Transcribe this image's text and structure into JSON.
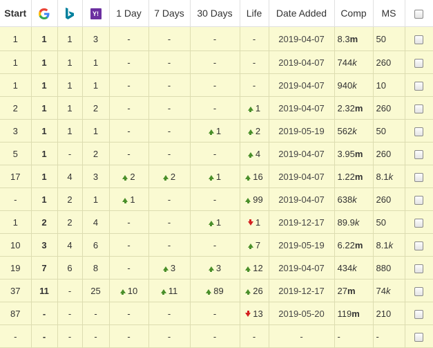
{
  "columns": {
    "start": "Start",
    "one_day": "1 Day",
    "seven_days": "7 Days",
    "thirty_days": "30 Days",
    "life": "Life",
    "date_added": "Date Added",
    "comp": "Comp",
    "ms": "MS"
  },
  "icons": {
    "google": "google-icon",
    "bing": "bing-icon",
    "yahoo": "yahoo-icon",
    "yahoo_glyph": "Y!"
  },
  "colors": {
    "row_bg": "#fafad2",
    "up": "#4a8f2a",
    "down": "#d42020"
  },
  "rows": [
    {
      "start": "1",
      "google": "1",
      "bing": "1",
      "yahoo": "3",
      "d1": {
        "t": "-",
        "dir": ""
      },
      "d7": {
        "t": "-",
        "dir": ""
      },
      "d30": {
        "t": "-",
        "dir": ""
      },
      "life": {
        "t": "-",
        "dir": ""
      },
      "date": "2019-04-07",
      "comp_num": "8.3",
      "comp_sfx": "m",
      "ms_num": "50",
      "ms_sfx": ""
    },
    {
      "start": "1",
      "google": "1",
      "bing": "1",
      "yahoo": "1",
      "d1": {
        "t": "-",
        "dir": ""
      },
      "d7": {
        "t": "-",
        "dir": ""
      },
      "d30": {
        "t": "-",
        "dir": ""
      },
      "life": {
        "t": "-",
        "dir": ""
      },
      "date": "2019-04-07",
      "comp_num": "744",
      "comp_sfx": "k",
      "ms_num": "260",
      "ms_sfx": ""
    },
    {
      "start": "1",
      "google": "1",
      "bing": "1",
      "yahoo": "1",
      "d1": {
        "t": "-",
        "dir": ""
      },
      "d7": {
        "t": "-",
        "dir": ""
      },
      "d30": {
        "t": "-",
        "dir": ""
      },
      "life": {
        "t": "-",
        "dir": ""
      },
      "date": "2019-04-07",
      "comp_num": "940",
      "comp_sfx": "k",
      "ms_num": "10",
      "ms_sfx": ""
    },
    {
      "start": "2",
      "google": "1",
      "bing": "1",
      "yahoo": "2",
      "d1": {
        "t": "-",
        "dir": ""
      },
      "d7": {
        "t": "-",
        "dir": ""
      },
      "d30": {
        "t": "-",
        "dir": ""
      },
      "life": {
        "t": "1",
        "dir": "up"
      },
      "date": "2019-04-07",
      "comp_num": "2.32",
      "comp_sfx": "m",
      "ms_num": "260",
      "ms_sfx": ""
    },
    {
      "start": "3",
      "google": "1",
      "bing": "1",
      "yahoo": "1",
      "d1": {
        "t": "-",
        "dir": ""
      },
      "d7": {
        "t": "-",
        "dir": ""
      },
      "d30": {
        "t": "1",
        "dir": "up"
      },
      "life": {
        "t": "2",
        "dir": "up"
      },
      "date": "2019-05-19",
      "comp_num": "562",
      "comp_sfx": "k",
      "ms_num": "50",
      "ms_sfx": ""
    },
    {
      "start": "5",
      "google": "1",
      "bing": "-",
      "yahoo": "2",
      "d1": {
        "t": "-",
        "dir": ""
      },
      "d7": {
        "t": "-",
        "dir": ""
      },
      "d30": {
        "t": "-",
        "dir": ""
      },
      "life": {
        "t": "4",
        "dir": "up"
      },
      "date": "2019-04-07",
      "comp_num": "3.95",
      "comp_sfx": "m",
      "ms_num": "260",
      "ms_sfx": ""
    },
    {
      "start": "17",
      "google": "1",
      "bing": "4",
      "yahoo": "3",
      "d1": {
        "t": "2",
        "dir": "up"
      },
      "d7": {
        "t": "2",
        "dir": "up"
      },
      "d30": {
        "t": "1",
        "dir": "up"
      },
      "life": {
        "t": "16",
        "dir": "up"
      },
      "date": "2019-04-07",
      "comp_num": "1.22",
      "comp_sfx": "m",
      "ms_num": "8.1",
      "ms_sfx": "k"
    },
    {
      "start": "-",
      "google": "1",
      "bing": "2",
      "yahoo": "1",
      "d1": {
        "t": "1",
        "dir": "up"
      },
      "d7": {
        "t": "-",
        "dir": ""
      },
      "d30": {
        "t": "-",
        "dir": ""
      },
      "life": {
        "t": "99",
        "dir": "up"
      },
      "date": "2019-04-07",
      "comp_num": "638",
      "comp_sfx": "k",
      "ms_num": "260",
      "ms_sfx": ""
    },
    {
      "start": "1",
      "google": "2",
      "bing": "2",
      "yahoo": "4",
      "d1": {
        "t": "-",
        "dir": ""
      },
      "d7": {
        "t": "-",
        "dir": ""
      },
      "d30": {
        "t": "1",
        "dir": "up"
      },
      "life": {
        "t": "1",
        "dir": "down"
      },
      "date": "2019-12-17",
      "comp_num": "89.9",
      "comp_sfx": "k",
      "ms_num": "50",
      "ms_sfx": ""
    },
    {
      "start": "10",
      "google": "3",
      "bing": "4",
      "yahoo": "6",
      "d1": {
        "t": "-",
        "dir": ""
      },
      "d7": {
        "t": "-",
        "dir": ""
      },
      "d30": {
        "t": "-",
        "dir": ""
      },
      "life": {
        "t": "7",
        "dir": "up"
      },
      "date": "2019-05-19",
      "comp_num": "6.22",
      "comp_sfx": "m",
      "ms_num": "8.1",
      "ms_sfx": "k"
    },
    {
      "start": "19",
      "google": "7",
      "bing": "6",
      "yahoo": "8",
      "d1": {
        "t": "-",
        "dir": ""
      },
      "d7": {
        "t": "3",
        "dir": "up"
      },
      "d30": {
        "t": "3",
        "dir": "up"
      },
      "life": {
        "t": "12",
        "dir": "up"
      },
      "date": "2019-04-07",
      "comp_num": "434",
      "comp_sfx": "k",
      "ms_num": "880",
      "ms_sfx": ""
    },
    {
      "start": "37",
      "google": "11",
      "bing": "-",
      "yahoo": "25",
      "d1": {
        "t": "10",
        "dir": "up"
      },
      "d7": {
        "t": "11",
        "dir": "up"
      },
      "d30": {
        "t": "89",
        "dir": "up"
      },
      "life": {
        "t": "26",
        "dir": "up"
      },
      "date": "2019-12-17",
      "comp_num": "27",
      "comp_sfx": "m",
      "ms_num": "74",
      "ms_sfx": "k"
    },
    {
      "start": "87",
      "google": "-",
      "bing": "-",
      "yahoo": "-",
      "d1": {
        "t": "-",
        "dir": ""
      },
      "d7": {
        "t": "-",
        "dir": ""
      },
      "d30": {
        "t": "-",
        "dir": ""
      },
      "life": {
        "t": "13",
        "dir": "down"
      },
      "date": "2019-05-20",
      "comp_num": "119",
      "comp_sfx": "m",
      "ms_num": "210",
      "ms_sfx": ""
    },
    {
      "start": "-",
      "google": "-",
      "bing": "-",
      "yahoo": "-",
      "d1": {
        "t": "-",
        "dir": ""
      },
      "d7": {
        "t": "-",
        "dir": ""
      },
      "d30": {
        "t": "-",
        "dir": ""
      },
      "life": {
        "t": "-",
        "dir": ""
      },
      "date": "-",
      "comp_num": "-",
      "comp_sfx": "",
      "ms_num": "-",
      "ms_sfx": ""
    }
  ]
}
